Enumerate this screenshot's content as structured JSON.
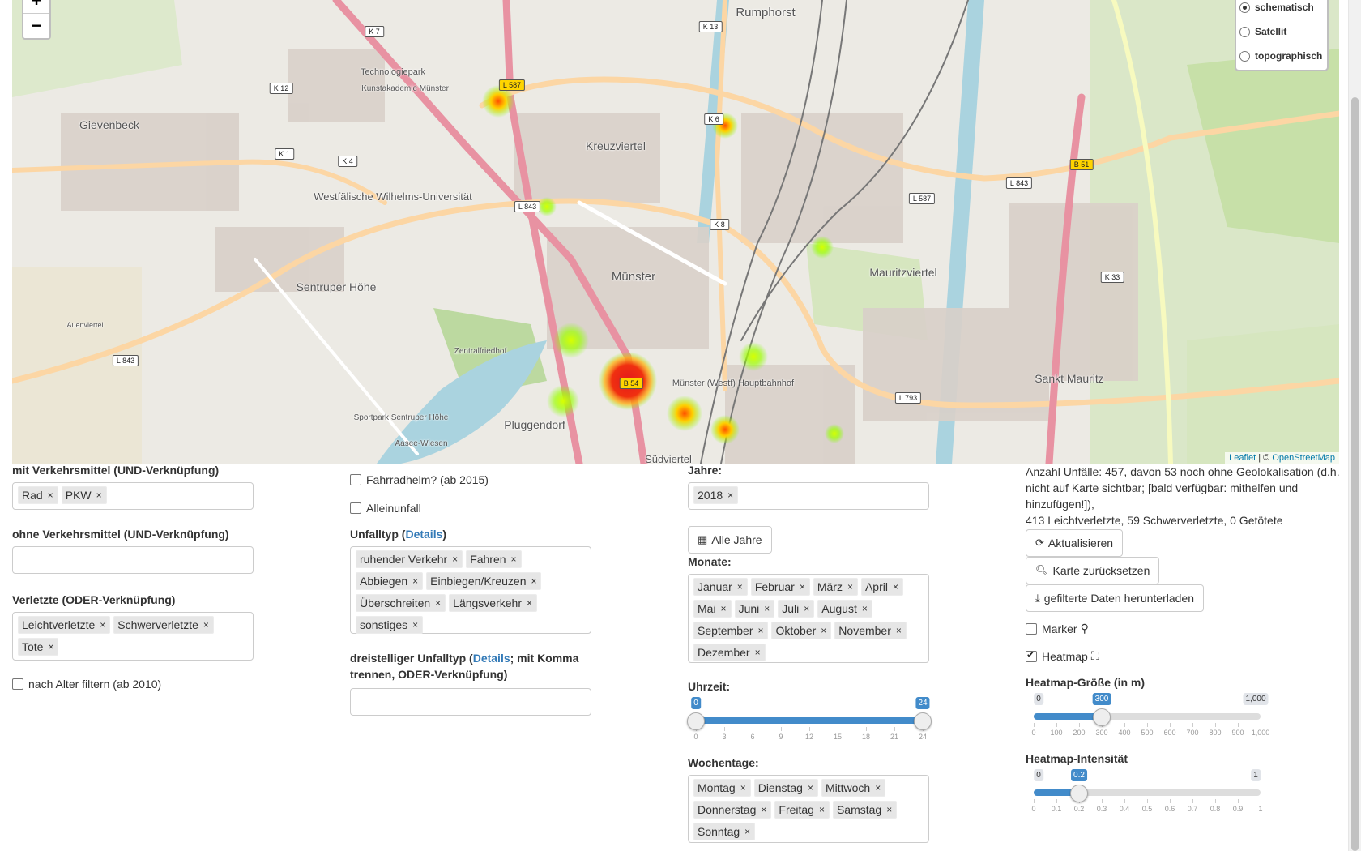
{
  "map": {
    "zoom_in": "+",
    "zoom_out": "−",
    "layers": [
      {
        "label": "schematisch",
        "checked": true
      },
      {
        "label": "Satellit",
        "checked": false
      },
      {
        "label": "topographisch",
        "checked": false
      }
    ],
    "attribution_leaflet": "Leaflet",
    "attribution_sep": " | © ",
    "attribution_osm": "OpenStreetMap",
    "place_labels": [
      "Rumphorst",
      "Technologiepark",
      "Kunstakademie Münster",
      "Gievenbeck",
      "Kreuzviertel",
      "Westfälische Wilhelms-Universität",
      "Münster",
      "Sentruper Höhe",
      "Mauritzviertel",
      "Zentralfriedhof",
      "Münster (Westf) Hauptbahnhof",
      "Sankt Mauritz",
      "Pluggendorf",
      "Sportpark Sentruper Höhe",
      "Aasee-Wiesen",
      "Südviertel",
      "Auenviertel"
    ],
    "road_labels": [
      "K 7",
      "K 13",
      "K 12",
      "L 587",
      "K 6",
      "K 1",
      "K 4",
      "L 843",
      "L 587",
      "K 8",
      "B 51",
      "L 843",
      "K 33",
      "L 843",
      "B 54",
      "L 793"
    ],
    "heat_colors": {
      "hot": "#e31a1c",
      "warm": "#ff7f00",
      "mid": "#ffff33",
      "cool": "#7fff00"
    }
  },
  "filters": {
    "with_transport_label": "mit Verkehrsmittel (UND-Verknüpfung)",
    "with_transport_chips": [
      "Rad",
      "PKW"
    ],
    "without_transport_label": "ohne Verkehrsmittel (UND-Verknüpfung)",
    "injured_label": "Verletzte (ODER-Verknüpfung)",
    "injured_chips": [
      "Leichtverletzte",
      "Schwerverletzte",
      "Tote"
    ],
    "age_filter_label": "nach Alter filtern (ab 2010)",
    "helmet_label": "Fahrradhelm? (ab 2015)",
    "single_accident_label": "Alleinunfall",
    "accident_type_label_pre": "Unfalltyp (",
    "accident_type_details": "Details",
    "accident_type_label_post": ")",
    "accident_type_chips": [
      "ruhender Verkehr",
      "Fahren",
      "Abbiegen",
      "Einbiegen/Kreuzen",
      "Überschreiten",
      "Längsverkehr",
      "sonstiges"
    ],
    "three_digit_label_pre": "dreistelliger Unfalltyp (",
    "three_digit_details": "Details",
    "three_digit_label_post": "; mit Komma trennen, ODER-Verknüpfung)",
    "years_label": "Jahre:",
    "years_chips": [
      "2018"
    ],
    "all_years_button": "Alle Jahre",
    "months_label": "Monate:",
    "months_chips": [
      "Januar",
      "Februar",
      "März",
      "April",
      "Mai",
      "Juni",
      "Juli",
      "August",
      "September",
      "Oktober",
      "November",
      "Dezember"
    ],
    "time_label": "Uhrzeit:",
    "time_slider": {
      "min": 0,
      "max": 24,
      "from": 0,
      "to": 24,
      "ticks": [
        "0",
        "3",
        "6",
        "9",
        "12",
        "15",
        "18",
        "21",
        "24"
      ],
      "from_label": "0",
      "to_label": "24"
    },
    "weekdays_label": "Wochentage:",
    "weekdays_chips": [
      "Montag",
      "Dienstag",
      "Mittwoch",
      "Donnerstag",
      "Freitag",
      "Samstag",
      "Sonntag"
    ]
  },
  "summary": {
    "line1": "Anzahl Unfälle: 457, davon 53 noch ohne Geolokalisation (d.h. nicht auf Karte sichtbar; [bald verfügbar: mithelfen und hinzufügen!]),",
    "line2": "413 Leichtverletzte, 59 Schwerverletzte, 0 Getötete",
    "refresh_button": "Aktualisieren",
    "reset_map_button": "Karte zurücksetzen",
    "download_button": "gefilterte Daten herunterladen",
    "marker_label": "Marker",
    "marker_checked": false,
    "heatmap_label": "Heatmap",
    "heatmap_checked": true,
    "heatmap_size_label": "Heatmap-Größe (in m)",
    "heatmap_size_slider": {
      "min": 0,
      "max": 1000,
      "value": 300,
      "min_label": "0",
      "max_label": "1,000",
      "value_label": "300",
      "ticks": [
        "0",
        "100",
        "200",
        "300",
        "400",
        "500",
        "600",
        "700",
        "800",
        "900",
        "1,000"
      ]
    },
    "heatmap_intensity_label": "Heatmap-Intensität",
    "heatmap_intensity_slider": {
      "min": 0,
      "max": 1,
      "value": 0.2,
      "min_label": "0",
      "max_label": "1",
      "value_label": "0.2",
      "ticks": [
        "0",
        "0.1",
        "0.2",
        "0.3",
        "0.4",
        "0.5",
        "0.6",
        "0.7",
        "0.8",
        "0.9",
        "1"
      ]
    }
  }
}
